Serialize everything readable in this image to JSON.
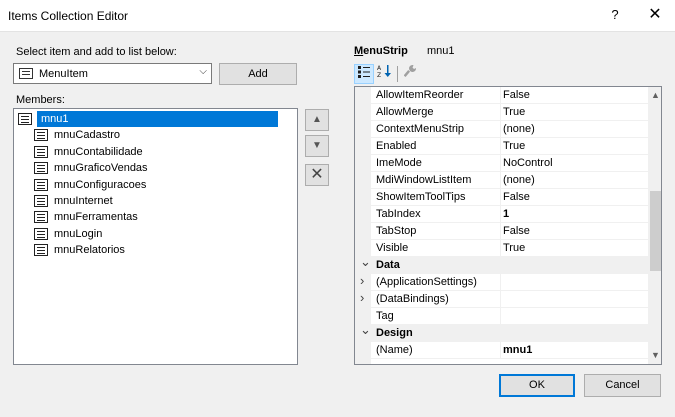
{
  "window": {
    "title": "Items Collection Editor",
    "help_glyph": "?",
    "close_glyph": "✕"
  },
  "left": {
    "select_label": "Select item and add to list below:",
    "combo_value": "MenuItem",
    "add_label": "Add",
    "members_label": "Members:",
    "members": [
      {
        "label": "mnu1",
        "selected": true
      },
      {
        "label": "mnuCadastro"
      },
      {
        "label": "mnuContabilidade"
      },
      {
        "label": "mnuGraficoVendas"
      },
      {
        "label": "mnuConfiguracoes"
      },
      {
        "label": "mnuInternet"
      },
      {
        "label": "mnuFerramentas"
      },
      {
        "label": "mnuLogin"
      },
      {
        "label": "mnuRelatorios"
      }
    ],
    "move_up_glyph": "▲",
    "move_down_glyph": "▼",
    "remove_glyph": "✕"
  },
  "right": {
    "type_prefix": "M",
    "type_rest": "enuStrip",
    "object_name": "mnu1",
    "toolbar": {
      "categorized_icon": "categorized-icon",
      "alphabetical_icon": "alphabetical-icon",
      "property_pages_icon": "property-pages-icon"
    },
    "properties": [
      {
        "name": "AllowItemReorder",
        "value": "False"
      },
      {
        "name": "AllowMerge",
        "value": "True"
      },
      {
        "name": "ContextMenuStrip",
        "value": "(none)"
      },
      {
        "name": "Enabled",
        "value": "True"
      },
      {
        "name": "ImeMode",
        "value": "NoControl"
      },
      {
        "name": "MdiWindowListItem",
        "value": "(none)"
      },
      {
        "name": "ShowItemToolTips",
        "value": "False"
      },
      {
        "name": "TabIndex",
        "value": "1"
      },
      {
        "name": "TabStop",
        "value": "False"
      },
      {
        "name": "Visible",
        "value": "True"
      },
      {
        "name": "Data",
        "category": true
      },
      {
        "name": "(ApplicationSettings)",
        "value": "",
        "expandable": true
      },
      {
        "name": "(DataBindings)",
        "value": "",
        "expandable": true
      },
      {
        "name": "Tag",
        "value": ""
      },
      {
        "name": "Design",
        "category": true
      },
      {
        "name": "(Name)",
        "value": "mnu1"
      }
    ]
  },
  "footer": {
    "ok_label": "OK",
    "cancel_label": "Cancel"
  }
}
